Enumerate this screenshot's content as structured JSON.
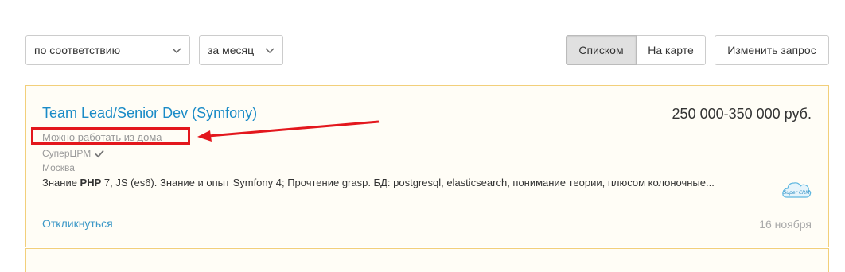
{
  "filters": {
    "sort_value": "по соответствию",
    "period_value": "за месяц"
  },
  "view_toggle": {
    "list_label": "Списком",
    "map_label": "На карте",
    "active": "list"
  },
  "edit_query_label": "Изменить запрос",
  "vacancy": {
    "title": "Team Lead/Senior Dev (Symfony)",
    "salary": "250 000-350 000 руб.",
    "remote_note": "Можно работать из дома",
    "employer": "СуперЦРМ",
    "city": "Москва",
    "description_parts": {
      "before_bold": "Знание ",
      "bold": "PHP",
      "after_bold": " 7, JS (es6). Знание и опыт Symfony 4; Прочтение grasp. БД: postgresql, elasticsearch, понимание теории, плюсом колоночные..."
    },
    "logo_text": "Super CRM",
    "respond_label": "Откликнуться",
    "date": "16 ноября"
  },
  "colors": {
    "link": "#1a8bc7",
    "card_border": "#f2cf7a",
    "annotation_red": "#e3171d"
  },
  "icons": [
    "chevron-down-icon",
    "verified-check-icon",
    "company-logo-icon"
  ]
}
